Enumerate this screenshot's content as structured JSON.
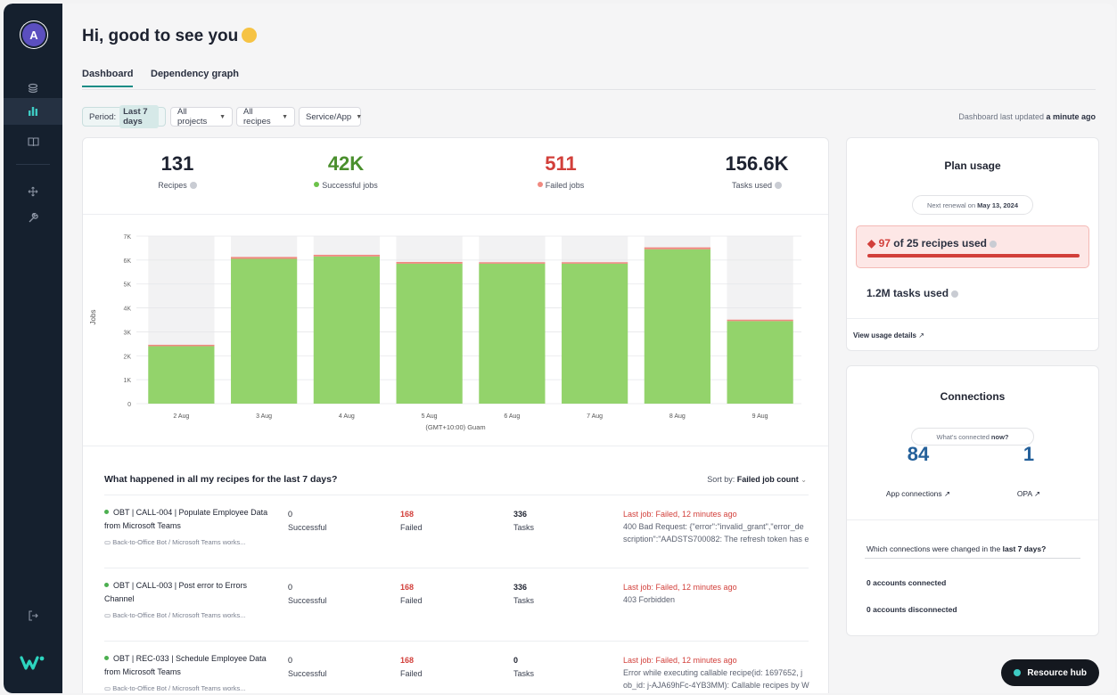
{
  "greeting": "Hi, good to see you",
  "tabs": [
    {
      "label": "Dashboard"
    },
    {
      "label": "Dependency graph"
    }
  ],
  "filters": {
    "period_label": "Period:",
    "period_value": "Last 7 days",
    "projects": "All projects",
    "recipes": "All recipes",
    "service": "Service/App"
  },
  "updated": {
    "prefix": "Dashboard last updated",
    "value": "a minute ago"
  },
  "stats": [
    {
      "value": "131",
      "label": "Recipes",
      "color": "#1d2230"
    },
    {
      "value": "42K",
      "label": "Successful jobs",
      "color": "#4a8f2d"
    },
    {
      "value": "511",
      "label": "Failed jobs",
      "color": "#d23f3a"
    },
    {
      "value": "156.6K",
      "label": "Tasks used",
      "color": "#1d2230"
    }
  ],
  "chart_data": {
    "type": "bar",
    "categories": [
      "2 Aug",
      "3 Aug",
      "4 Aug",
      "5 Aug",
      "6 Aug",
      "7 Aug",
      "8 Aug",
      "9 Aug"
    ],
    "series": [
      {
        "values": [
          2400,
          6050,
          6150,
          5850,
          5850,
          5850,
          6450,
          3450
        ],
        "color": "#93d36b"
      },
      {
        "values": [
          60,
          80,
          70,
          70,
          60,
          60,
          80,
          60
        ],
        "color": "#f08a80"
      }
    ],
    "stacked": true,
    "ylabel": "Jobs",
    "xlabel": "(GMT+10:00) Guam",
    "ylim": [
      0,
      7000
    ],
    "yticks": [
      "0",
      "1K",
      "2K",
      "3K",
      "4K",
      "5K",
      "6K",
      "7K"
    ],
    "grid": true
  },
  "recipes_section": {
    "title": "What happened in all my recipes for the last 7 days?",
    "sort_label": "Sort by:",
    "sort_value": "Failed job count",
    "rows": [
      {
        "name": "OBT | CALL-004 | Populate Employee Data from Microsoft Teams",
        "folder": "Back-to-Office Bot / Microsoft Teams works...",
        "successful": "0",
        "successful_label": "Successful",
        "failed": "168",
        "failed_label": "Failed",
        "tasks": "336",
        "tasks_label": "Tasks",
        "last_job": "Last job: Failed, 12 minutes ago",
        "error": "400 Bad Request: {\"error\":\"invalid_grant\",\"error_de scription\":\"AADSTS700082: The refresh token has e"
      },
      {
        "name": "OBT | CALL-003 | Post error to Errors Channel",
        "folder": "Back-to-Office Bot / Microsoft Teams works...",
        "successful": "0",
        "successful_label": "Successful",
        "failed": "168",
        "failed_label": "Failed",
        "tasks": "336",
        "tasks_label": "Tasks",
        "last_job": "Last job: Failed, 12 minutes ago",
        "error": "403 Forbidden"
      },
      {
        "name": "OBT | REC-033 | Schedule Employee Data from Microsoft Teams",
        "folder": "Back-to-Office Bot / Microsoft Teams works...",
        "successful": "0",
        "successful_label": "Successful",
        "failed": "168",
        "failed_label": "Failed",
        "tasks": "0",
        "tasks_label": "Tasks",
        "last_job": "Last job: Failed, 12 minutes ago",
        "error": "Error while executing callable recipe(id: 1697652, j ob_id: j-AJA69hFc-4YB3MM): Callable recipes by W"
      }
    ]
  },
  "plan": {
    "title": "Plan usage",
    "renewal_prefix": "Next renewal on",
    "renewal_date": "May 13, 2024",
    "recipes_used_count": "97",
    "recipes_used_rest": "of 25 recipes used",
    "recipes_used_fraction": 1.0,
    "tasks_used": "1.2M tasks used",
    "details_link": "View usage details"
  },
  "connections": {
    "title": "Connections",
    "pill_prefix": "What's connected",
    "pill_strong": "now?",
    "app_count": "84",
    "app_label": "App connections",
    "opa_count": "1",
    "opa_label": "OPA",
    "question_prefix": "Which connections were changed in the",
    "question_strong": "last 7 days?",
    "connected": "0 accounts connected",
    "disconnected": "0 accounts disconnected"
  },
  "avatar_letter": "A",
  "resource_hub": "Resource hub"
}
